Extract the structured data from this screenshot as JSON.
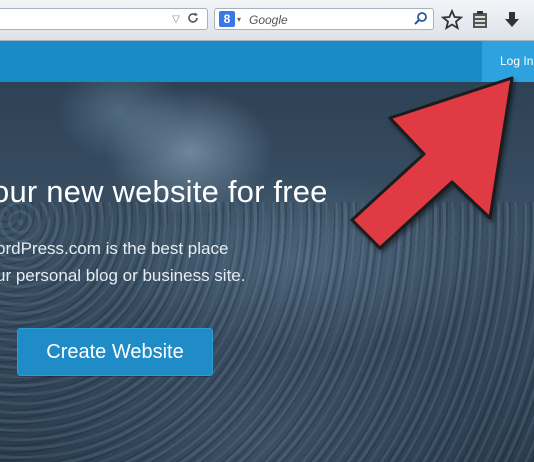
{
  "browser": {
    "search_placeholder": "Google",
    "engine_letter": "8",
    "icons": [
      "url-dropdown-icon",
      "reload-icon",
      "google-icon",
      "search-icon",
      "bookmark-star-icon",
      "clipboard-icon",
      "download-icon"
    ]
  },
  "site": {
    "login_label": "Log In",
    "header_color": "#1b8bc5"
  },
  "hero": {
    "title": "our new website for free",
    "subtitle_line1": "ordPress.com is the best place",
    "subtitle_line2": "ur personal blog or business site.",
    "cta_label": "Create Website",
    "cta_color": "#1f8bc7"
  },
  "annotation": {
    "arrow_color": "#e03a44",
    "arrow_target": "login-button"
  }
}
